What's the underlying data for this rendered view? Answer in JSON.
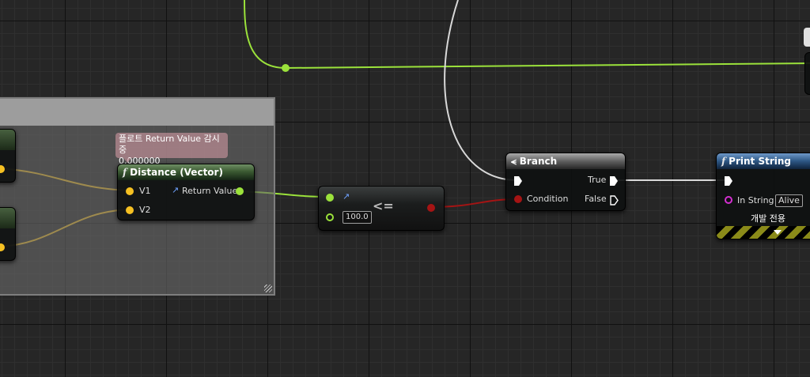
{
  "nodes": {
    "distance": {
      "title": "Distance (Vector)",
      "pin_v1": "V1",
      "pin_v2": "V2",
      "pin_return": "Return Value",
      "watch_label": "플로트 Return Value 감시중",
      "watch_value": "0.000000"
    },
    "compare": {
      "operator": "<=",
      "default_value": "100.0"
    },
    "branch": {
      "title": "Branch",
      "pin_condition": "Condition",
      "pin_true": "True",
      "pin_false": "False"
    },
    "print_string": {
      "title": "Print String",
      "pin_in_string": "In String",
      "in_string_value": "Alive",
      "dev_only_label": "개발 전용"
    }
  },
  "colors": {
    "float_pin": "#9be23b",
    "vector_pin": "#f5c022",
    "bool_pin": "#a51414",
    "string_pin": "#d42fd1",
    "exec_wire": "#d9d9d9",
    "grid_bg": "#262626"
  },
  "icons": [
    "function-icon",
    "branch-icon",
    "dropdown-chevron-icon",
    "float-type-icon"
  ]
}
